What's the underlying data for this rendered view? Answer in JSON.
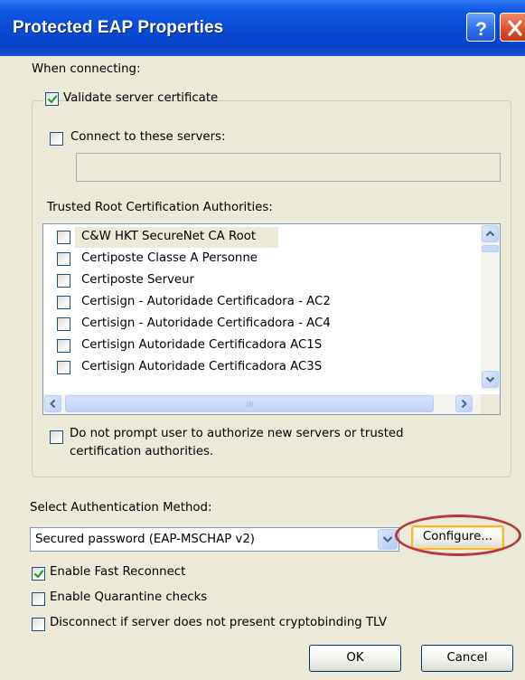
{
  "window": {
    "title": "Protected EAP Properties",
    "help_button": "?",
    "close_button": "X"
  },
  "when_connecting": {
    "label": "When connecting:",
    "validate_server_certificate": {
      "label": "Validate server certificate",
      "checked": true
    },
    "connect_to_these_servers": {
      "label": "Connect to these servers:",
      "checked": false,
      "value": ""
    },
    "trusted_root_label": "Trusted Root Certification Authorities:",
    "trusted_roots": [
      {
        "label": "C&W HKT SecureNet CA Root",
        "checked": false
      },
      {
        "label": "Certiposte Classe A Personne",
        "checked": false
      },
      {
        "label": "Certiposte Serveur",
        "checked": false
      },
      {
        "label": "Certisign - Autoridade Certificadora - AC2",
        "checked": false
      },
      {
        "label": "Certisign - Autoridade Certificadora - AC4",
        "checked": false
      },
      {
        "label": "Certisign Autoridade Certificadora AC1S",
        "checked": false
      },
      {
        "label": "Certisign Autoridade Certificadora AC3S",
        "checked": false
      }
    ],
    "do_not_prompt": {
      "line1": "Do not prompt user to authorize new servers or trusted",
      "line2": "certification authorities.",
      "checked": false
    }
  },
  "auth": {
    "label": "Select Authentication Method:",
    "selected": "Secured password (EAP-MSCHAP v2)",
    "configure_label": "Configure..."
  },
  "options": {
    "enable_fast_reconnect": {
      "label": "Enable Fast Reconnect",
      "checked": true
    },
    "enable_quarantine_checks": {
      "label": "Enable Quarantine checks",
      "checked": false
    },
    "disconnect_cryptobinding": {
      "label": "Disconnect if server does not present cryptobinding TLV",
      "checked": false
    }
  },
  "buttons": {
    "ok": "OK",
    "cancel": "Cancel"
  },
  "colors": {
    "titlebar": "#0A4BD7",
    "dialog_bg": "#ECE9D8",
    "highlight_ring": "#B33B3B",
    "check_green": "#21A121"
  }
}
